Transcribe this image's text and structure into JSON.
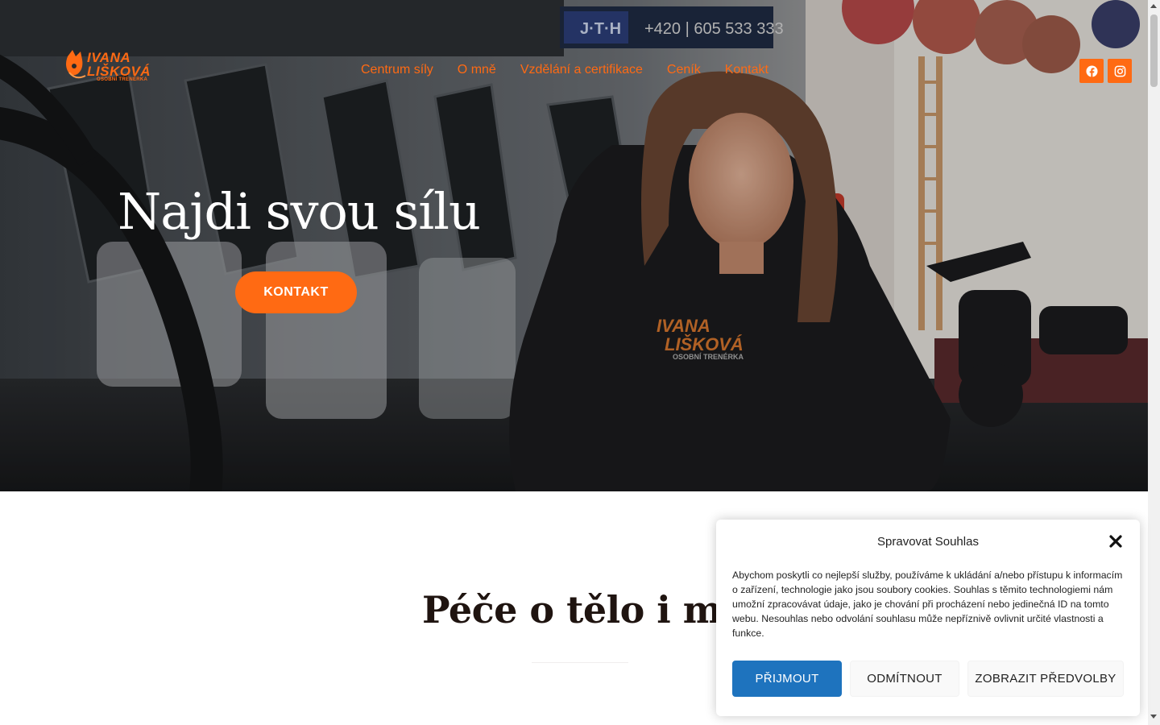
{
  "colors": {
    "accent": "#ff6a13",
    "hero_title": "#ffffff",
    "section_title": "#1f1410",
    "accept_button": "#1e73be"
  },
  "logo": {
    "line1": "IVANA",
    "line2": "LIŠKOVÁ",
    "subtitle": "OSOBNÍ TRENÉRKA"
  },
  "nav": {
    "items": [
      {
        "label": "Centrum síly"
      },
      {
        "label": "O mně"
      },
      {
        "label": "Vzdělání a certifikace"
      },
      {
        "label": "Ceník"
      },
      {
        "label": "Kontakt"
      }
    ]
  },
  "social": [
    {
      "icon": "facebook-icon"
    },
    {
      "icon": "instagram-icon"
    }
  ],
  "hero": {
    "title": "Najdi svou sílu",
    "button_label": "KONTAKT",
    "background_sign_text": "+420 | 605 533 333"
  },
  "section": {
    "title": "Péče o tělo i mys"
  },
  "cookie_dialog": {
    "title": "Spravovat Souhlas",
    "text": "Abychom poskytli co nejlepší služby, používáme k ukládání a/nebo přístupu k informacím o zařízení, technologie jako jsou soubory cookies. Souhlas s těmito technologiemi nám umožní zpracovávat údaje, jako je chování při procházení nebo jedinečná ID na tomto webu. Nesouhlas nebo odvolání souhlasu může nepříznivě ovlivnit určité vlastnosti a funkce.",
    "accept_label": "PŘIJMOUT",
    "deny_label": "ODMÍTNOUT",
    "prefs_label": "ZOBRAZIT PŘEDVOLBY"
  }
}
